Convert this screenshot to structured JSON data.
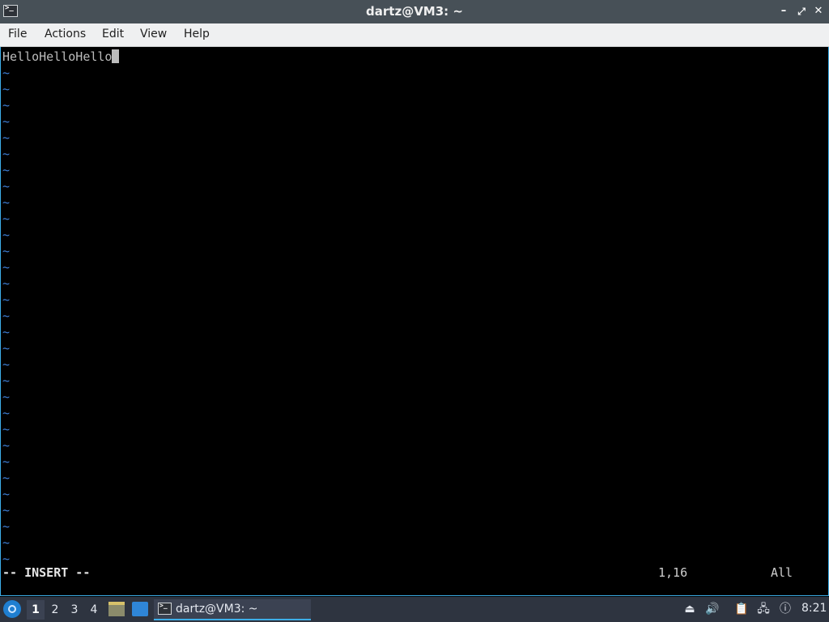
{
  "window": {
    "title": "dartz@VM3: ~",
    "controls": {
      "minimize": "–",
      "maximize": "⤢",
      "close": "✕"
    }
  },
  "menubar": {
    "items": [
      "File",
      "Actions",
      "Edit",
      "View",
      "Help"
    ]
  },
  "editor": {
    "line1": "HelloHelloHello",
    "tilde_char": "~",
    "mode": "-- INSERT --",
    "position": "1,16",
    "scroll": "All"
  },
  "taskbar": {
    "workspaces": [
      "1",
      "2",
      "3",
      "4"
    ],
    "active_workspace": "1",
    "task_label": "dartz@VM3: ~",
    "clock": "8:21",
    "icons": {
      "start": "start-menu-icon",
      "files": "file-manager-icon",
      "desktop": "show-desktop-icon",
      "tray": [
        "eject-icon",
        "volume-icon",
        "clipboard-icon",
        "network-icon",
        "notification-icon",
        "battery-icon"
      ]
    }
  },
  "colors": {
    "terminal_bg": "#000000",
    "tilde": "#3e7fd6",
    "accent": "#3daee9",
    "titlebar": "#475057",
    "taskbar": "#2e3440"
  }
}
